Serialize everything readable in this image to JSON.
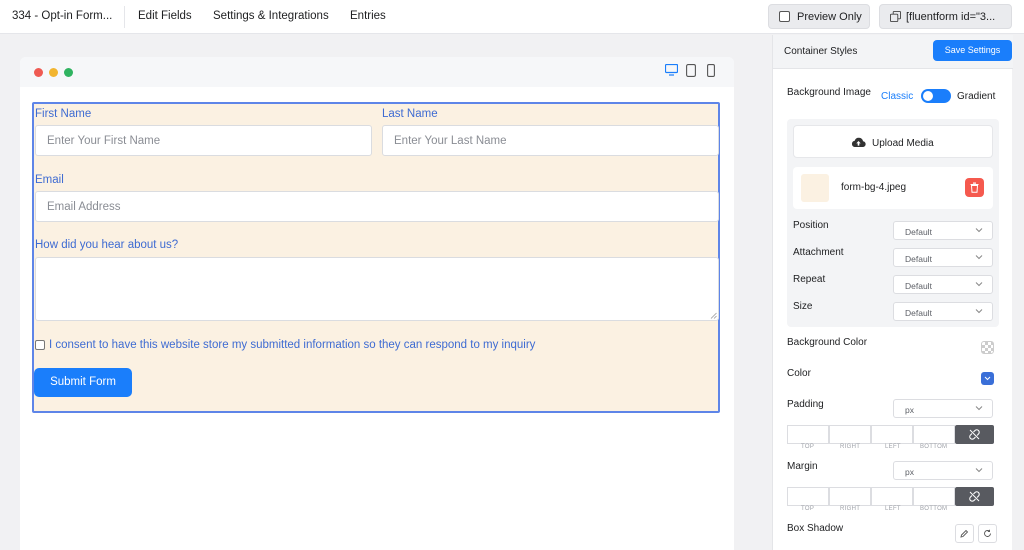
{
  "topbar": {
    "form_title": "334 - Opt-in Form...",
    "edit_fields": "Edit Fields",
    "settings": "Settings & Integrations",
    "entries": "Entries",
    "preview_only": "Preview Only",
    "shortcode": "[fluentform id=\"3..."
  },
  "form": {
    "first_name_label": "First Name",
    "first_name_placeholder": "Enter Your First Name",
    "last_name_label": "Last Name",
    "last_name_placeholder": "Enter Your Last Name",
    "email_label": "Email",
    "email_placeholder": "Email Address",
    "hear_label": "How did you hear about us?",
    "consent_text": "I consent to have this website store my submitted information so they can respond to my inquiry",
    "submit_label": "Submit Form",
    "background_color": "#fbf1e2"
  },
  "panel": {
    "title": "Container Styles",
    "save_label": "Save Settings",
    "bg_image_label": "Background Image",
    "classic_label": "Classic",
    "gradient_label": "Gradient",
    "upload_label": "Upload Media",
    "file_name": "form-bg-4.jpeg",
    "position_label": "Position",
    "position_value": "Default",
    "attachment_label": "Attachment",
    "attachment_value": "Default",
    "repeat_label": "Repeat",
    "repeat_value": "Default",
    "size_label": "Size",
    "size_value": "Default",
    "bg_color_label": "Background Color",
    "color_label": "Color",
    "color_value": "#3a6fd8",
    "padding_label": "Padding",
    "padding_unit": "px",
    "margin_label": "Margin",
    "margin_unit": "px",
    "box_top": "TOP",
    "box_right": "RIGHT",
    "box_left": "LEFT",
    "box_bottom": "BOTTOM",
    "box_shadow_label": "Box Shadow"
  },
  "colors": {
    "accent": "#1a7efb",
    "label_blue": "#3e6bd2",
    "delete_red": "#f5594e"
  }
}
